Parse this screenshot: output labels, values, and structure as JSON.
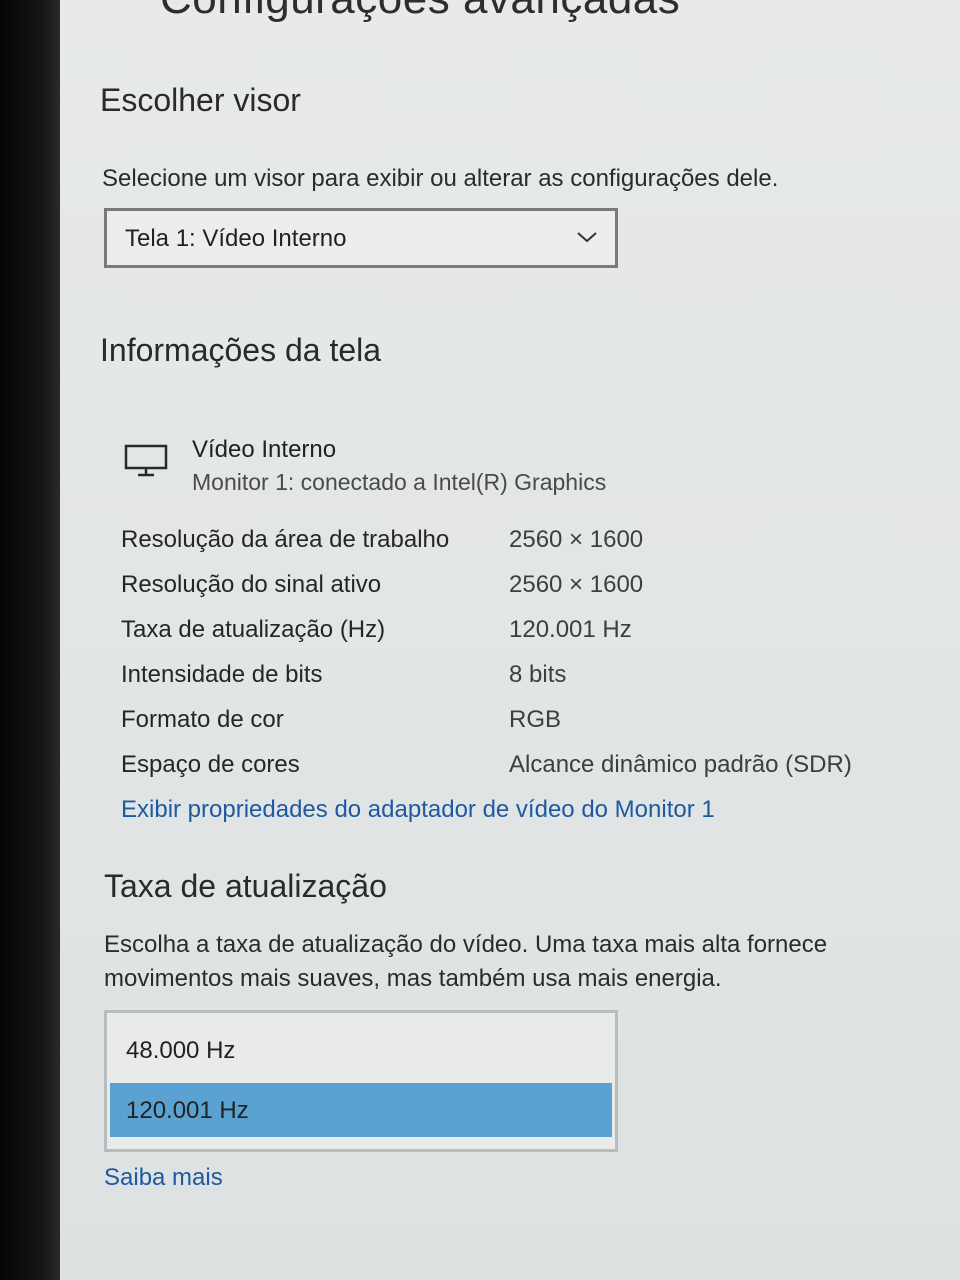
{
  "header": {
    "title": "Configurações avançadas"
  },
  "choose_display": {
    "heading": "Escolher visor",
    "description": "Selecione um visor para exibir ou alterar as configurações dele.",
    "selected_display": "Tela 1: Vídeo Interno"
  },
  "display_info": {
    "heading": "Informações da tela",
    "device_name": "Vídeo Interno",
    "device_subtitle": "Monitor 1: conectado a Intel(R) Graphics",
    "rows": [
      {
        "label": "Resolução da área de trabalho",
        "value": "2560 × 1600"
      },
      {
        "label": "Resolução do sinal ativo",
        "value": "2560 × 1600"
      },
      {
        "label": "Taxa de atualização (Hz)",
        "value": "120.001 Hz"
      },
      {
        "label": "Intensidade de bits",
        "value": "8 bits"
      },
      {
        "label": "Formato de cor",
        "value": "RGB"
      },
      {
        "label": "Espaço de cores",
        "value": "Alcance dinâmico padrão (SDR)"
      }
    ],
    "adapter_link": "Exibir propriedades do adaptador de vídeo do Monitor 1"
  },
  "refresh_rate": {
    "heading": "Taxa de atualização",
    "description_line1": "Escolha a taxa de atualização do vídeo. Uma taxa mais alta fornece",
    "description_line2": "movimentos mais suaves, mas também usa mais energia.",
    "options": [
      {
        "label": "48.000 Hz",
        "selected": false
      },
      {
        "label": "120.001 Hz",
        "selected": true
      }
    ],
    "learn_more": "Saiba mais"
  },
  "colors": {
    "page_background": "#e3e6e6",
    "link": "#1f5aa0",
    "selected_option": "#5aa2d2"
  },
  "icons": {
    "display_icon": "monitor-icon",
    "dropdown_icon": "chevron-down-icon"
  }
}
